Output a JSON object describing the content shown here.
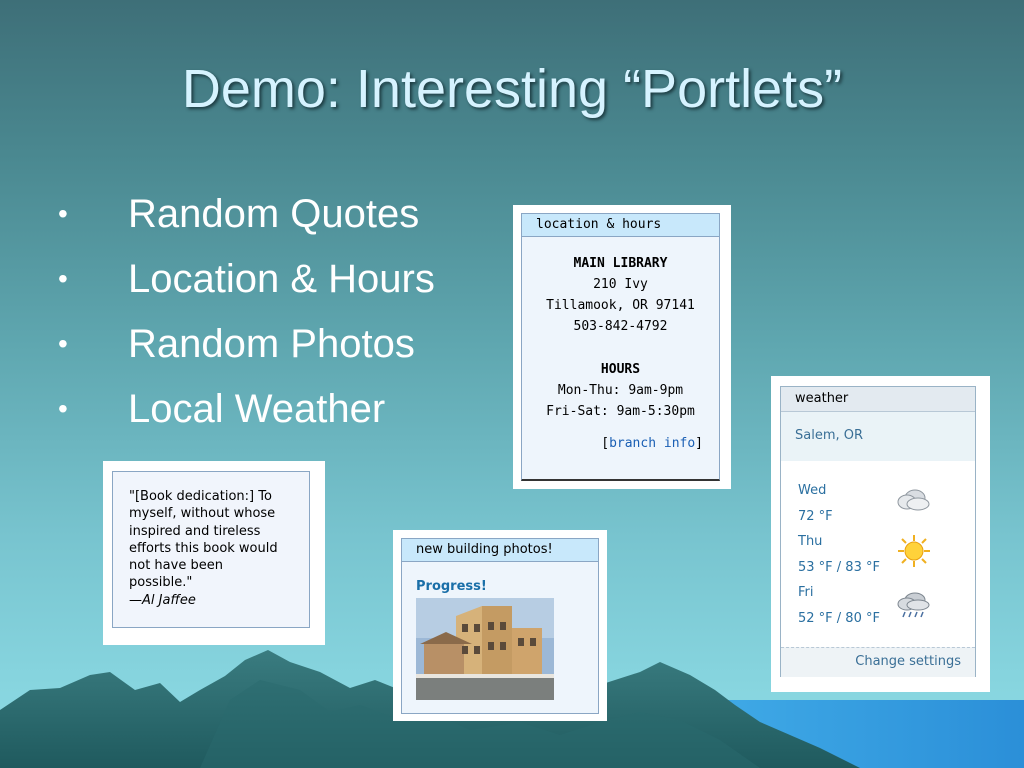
{
  "slide": {
    "title": "Demo: Interesting “Portlets”",
    "bullets": [
      "Random Quotes",
      "Location & Hours",
      "Random Photos",
      "Local Weather"
    ],
    "bullet_glyph": "•"
  },
  "location": {
    "header": "location & hours",
    "name": "MAIN LIBRARY",
    "street": "210 Ivy",
    "city": "Tillamook, OR 97141",
    "phone": "503-842-4792",
    "hours_title": "HOURS",
    "hours": [
      "Mon-Thu: 9am-9pm",
      "Fri-Sat: 9am-5:30pm"
    ],
    "bracket_open": "[",
    "link": "branch info",
    "bracket_close": "]"
  },
  "weather": {
    "header": "weather",
    "city": "Salem, OR",
    "days": [
      {
        "day": "Wed",
        "temp": "72 °F",
        "icon": "cloudy-icon"
      },
      {
        "day": "Thu",
        "temp": "53 °F / 83 °F",
        "icon": "sunny-icon"
      },
      {
        "day": "Fri",
        "temp": "52 °F / 80 °F",
        "icon": "rain-icon"
      }
    ],
    "settings": "Change settings"
  },
  "quote": {
    "lines": [
      "\"[Book dedication:] To",
      "myself, without whose",
      "inspired and tireless",
      "efforts this book would",
      "not have been",
      "possible.\""
    ],
    "author": "—Al Jaffee"
  },
  "photos": {
    "header": "new building photos!",
    "caption": "Progress!"
  },
  "colors": {
    "portlet_header": "#c8e8fb",
    "link": "#1a5fb4",
    "bg_top": "#3e6f78",
    "bg_bottom": "#8fdde6"
  }
}
